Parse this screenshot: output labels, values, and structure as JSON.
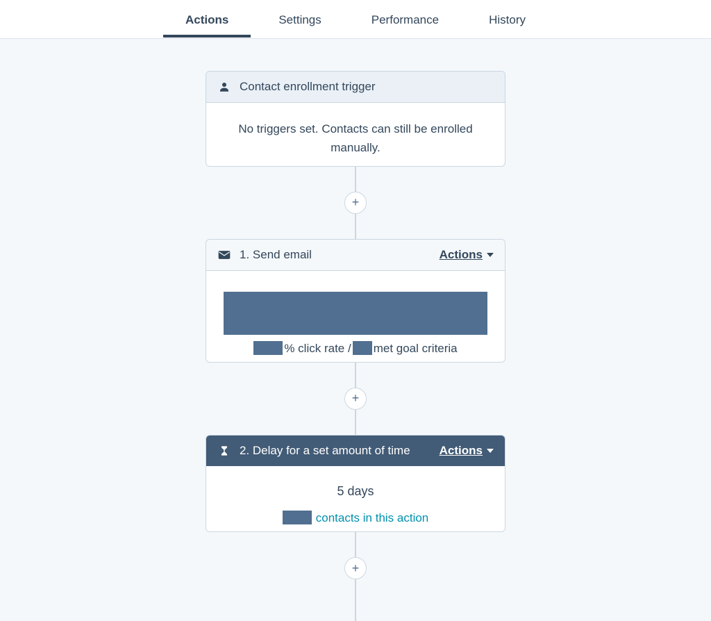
{
  "tabs": [
    {
      "label": "Actions",
      "active": true
    },
    {
      "label": "Settings",
      "active": false
    },
    {
      "label": "Performance",
      "active": false
    },
    {
      "label": "History",
      "active": false
    }
  ],
  "trigger_card": {
    "title": "Contact enrollment trigger",
    "body": "No triggers set. Contacts can still be enrolled manually."
  },
  "step1": {
    "title": "1. Send email",
    "actions_label": "Actions",
    "click_rate_suffix": "% click rate / ",
    "goal_suffix": "met goal criteria"
  },
  "step2": {
    "title": "2. Delay for a set amount of time",
    "actions_label": "Actions",
    "delay_value": "5 days",
    "contacts_link": "contacts in this action"
  },
  "plus_label": "+"
}
